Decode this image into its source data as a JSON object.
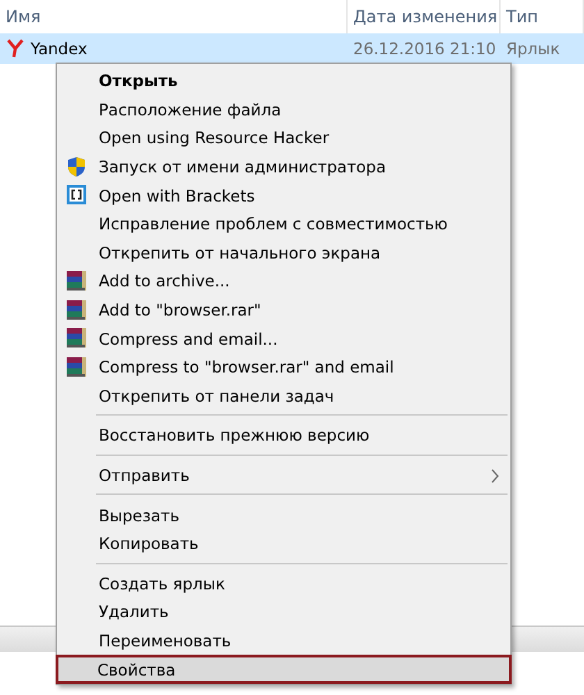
{
  "columns": [
    {
      "label": "Имя"
    },
    {
      "label": "Дата изменения"
    },
    {
      "label": "Тип"
    }
  ],
  "file": {
    "name": "Yandex",
    "modified": "26.12.2016 21:10",
    "type": "Ярлык",
    "selected": true
  },
  "menu": [
    {
      "kind": "item",
      "label": "Открыть",
      "default": true,
      "selected": false
    },
    {
      "kind": "item",
      "label": "Расположение файла",
      "default": false,
      "selected": false
    },
    {
      "kind": "item",
      "label": "Open using Resource Hacker",
      "default": false,
      "selected": false
    },
    {
      "kind": "shield",
      "label": "Запуск от имени администратора",
      "default": false,
      "selected": false
    },
    {
      "kind": "brackets",
      "label": "Open with Brackets",
      "default": false,
      "selected": false
    },
    {
      "kind": "item",
      "label": "Исправление проблем с совместимостью",
      "default": false,
      "selected": false
    },
    {
      "kind": "item",
      "label": "Открепить от начального экрана",
      "default": false,
      "selected": false
    },
    {
      "kind": "archive",
      "label": "Add to archive...",
      "default": false,
      "selected": false
    },
    {
      "kind": "archive",
      "label": "Add to \"browser.rar\"",
      "default": false,
      "selected": false
    },
    {
      "kind": "archive",
      "label": "Compress and email...",
      "default": false,
      "selected": false
    },
    {
      "kind": "archive",
      "label": "Compress to \"browser.rar\" and email",
      "default": false,
      "selected": false
    },
    {
      "kind": "item",
      "label": "Открепить от панели задач",
      "default": false,
      "selected": false
    },
    {
      "kind": "separator"
    },
    {
      "kind": "item",
      "label": "Восстановить прежнюю версию",
      "default": false,
      "selected": false
    },
    {
      "kind": "separator"
    },
    {
      "kind": "submenu",
      "label": "Отправить",
      "default": false,
      "selected": false
    },
    {
      "kind": "separator"
    },
    {
      "kind": "item",
      "label": "Вырезать",
      "default": false,
      "selected": false
    },
    {
      "kind": "item",
      "label": "Копировать",
      "default": false,
      "selected": false
    },
    {
      "kind": "separator"
    },
    {
      "kind": "item",
      "label": "Создать ярлык",
      "default": false,
      "selected": false
    },
    {
      "kind": "item",
      "label": "Удалить",
      "default": false,
      "selected": false
    },
    {
      "kind": "item",
      "label": "Переименовать",
      "default": false,
      "selected": false
    },
    {
      "kind": "item",
      "label": "Свойства",
      "default": false,
      "selected": true
    }
  ]
}
